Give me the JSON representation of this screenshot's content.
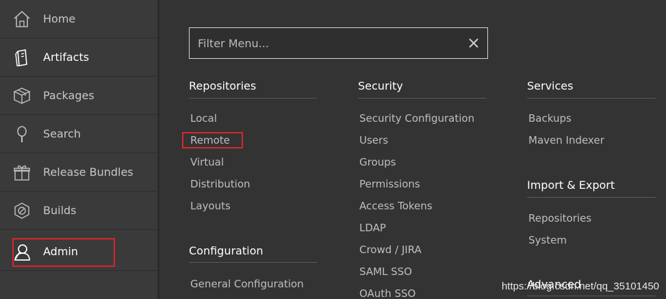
{
  "sidebar": {
    "items": [
      {
        "label": "Home",
        "icon": "home-icon"
      },
      {
        "label": "Artifacts",
        "icon": "artifacts-icon"
      },
      {
        "label": "Packages",
        "icon": "package-icon"
      },
      {
        "label": "Search",
        "icon": "search-icon"
      },
      {
        "label": "Release Bundles",
        "icon": "release-bundle-icon"
      },
      {
        "label": "Builds",
        "icon": "builds-icon"
      },
      {
        "label": "Admin",
        "icon": "admin-icon"
      }
    ]
  },
  "filter": {
    "placeholder": "Filter Menu..."
  },
  "repositories": {
    "title": "Repositories",
    "items": [
      "Local",
      "Remote",
      "Virtual",
      "Distribution",
      "Layouts"
    ]
  },
  "configuration": {
    "title": "Configuration",
    "items": [
      "General Configuration"
    ]
  },
  "security": {
    "title": "Security",
    "items": [
      "Security Configuration",
      "Users",
      "Groups",
      "Permissions",
      "Access Tokens",
      "LDAP",
      "Crowd / JIRA",
      "SAML SSO",
      "OAuth SSO"
    ]
  },
  "services": {
    "title": "Services",
    "items": [
      "Backups",
      "Maven Indexer"
    ]
  },
  "import_export": {
    "title": "Import & Export",
    "items": [
      "Repositories",
      "System"
    ]
  },
  "advanced": {
    "title": "Advanced"
  },
  "watermark": "https://blog.csdn.net/qq_35101450",
  "colors": {
    "highlight": "#d9262b",
    "background": "#333333",
    "sidebar": "#3a3a3a"
  }
}
